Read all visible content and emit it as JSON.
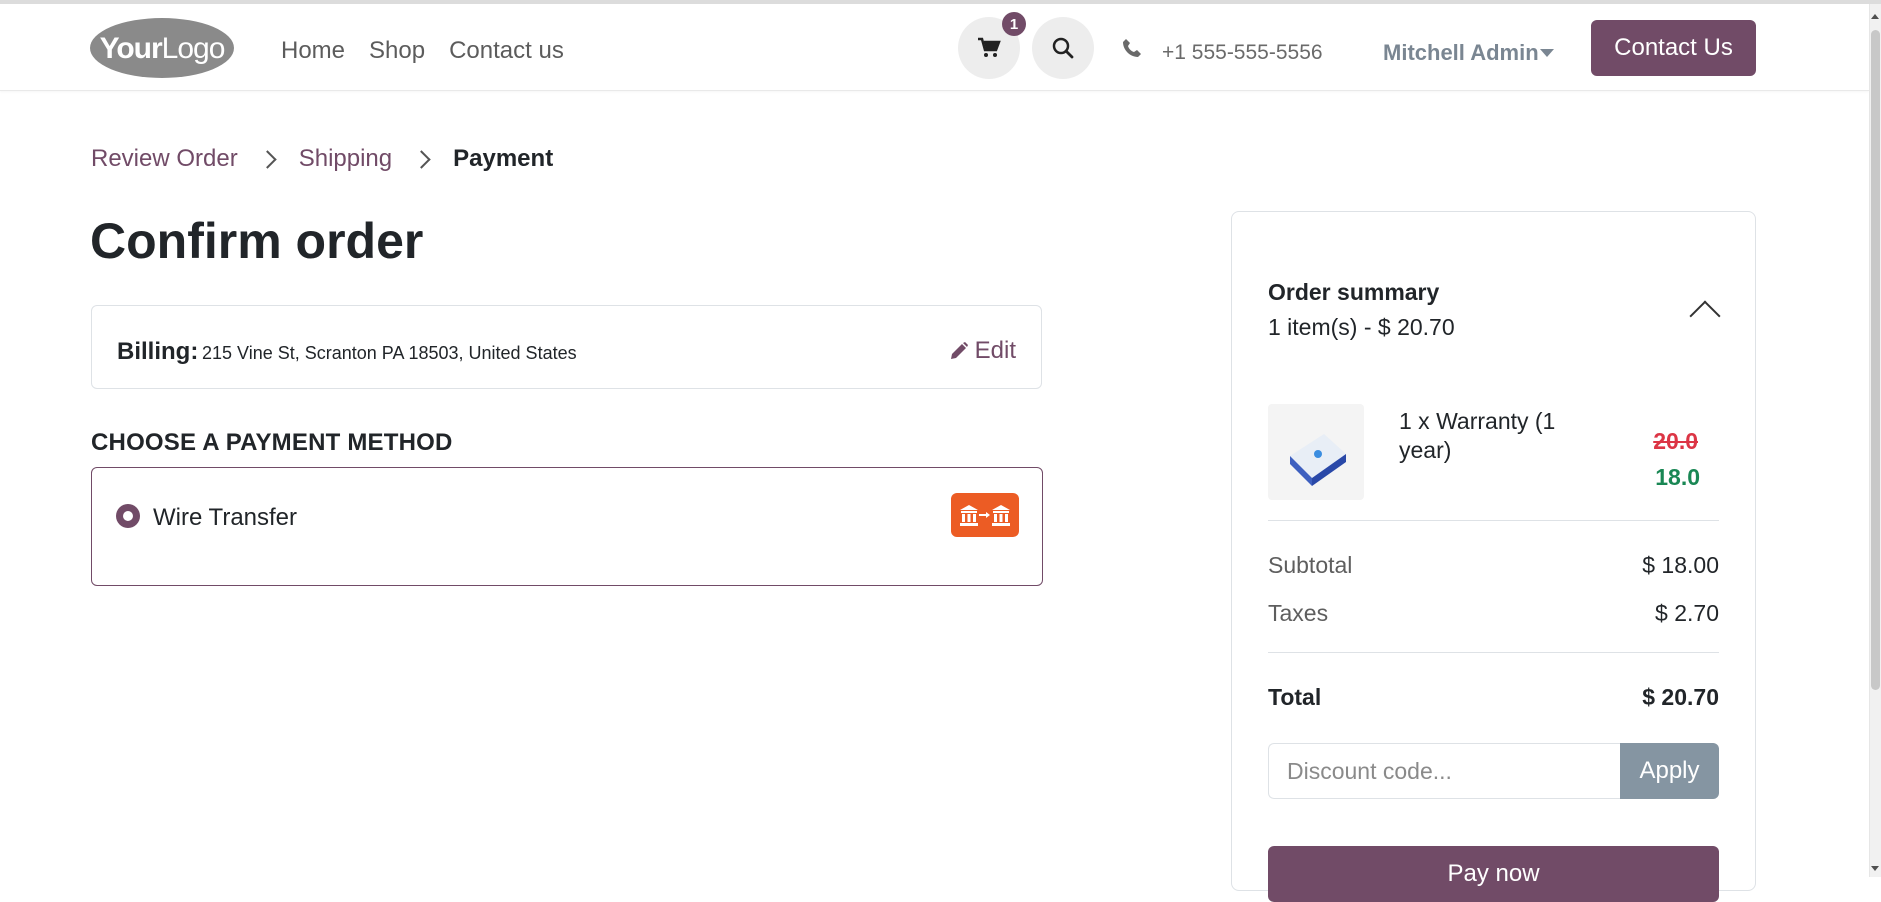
{
  "header": {
    "logo_text_bold": "Your",
    "logo_text_regular": "Logo",
    "nav": [
      {
        "label": "Home"
      },
      {
        "label": "Shop"
      },
      {
        "label": "Contact us"
      }
    ],
    "cart_count": "1",
    "phone": "+1 555-555-5556",
    "user_name": "Mitchell Admin",
    "cta_label": "Contact Us",
    "icons": [
      "cart-icon",
      "search-icon",
      "phone-icon",
      "chevron-down-icon"
    ]
  },
  "breadcrumb": {
    "items": [
      "Review Order",
      "Shipping"
    ],
    "current": "Payment"
  },
  "page_title": "Confirm order",
  "billing": {
    "label": "Billing:",
    "address": "215 Vine St, Scranton PA 18503, United States",
    "edit_label": "Edit"
  },
  "payment": {
    "heading": "CHOOSE A PAYMENT METHOD",
    "methods": [
      {
        "label": "Wire Transfer",
        "selected": true,
        "icon": "bank-transfer-icon"
      }
    ]
  },
  "summary": {
    "title": "Order summary",
    "subtitle": "1 item(s) -  $ 20.70",
    "item": {
      "name": "1 x Warranty (1 year)",
      "old_price": "20.0",
      "new_price": "18.0"
    },
    "subtotal_label": "Subtotal",
    "subtotal_value": "$ 18.00",
    "taxes_label": "Taxes",
    "taxes_value": "$ 2.70",
    "total_label": "Total",
    "total_value": "$ 20.70",
    "discount_placeholder": "Discount code...",
    "apply_label": "Apply",
    "pay_label": "Pay now"
  },
  "colors": {
    "brand": "#714b67",
    "price_old": "#dc3545",
    "price_new": "#198754",
    "apply_button": "#8595a2",
    "payment_icon_bg": "#ec5c24"
  }
}
